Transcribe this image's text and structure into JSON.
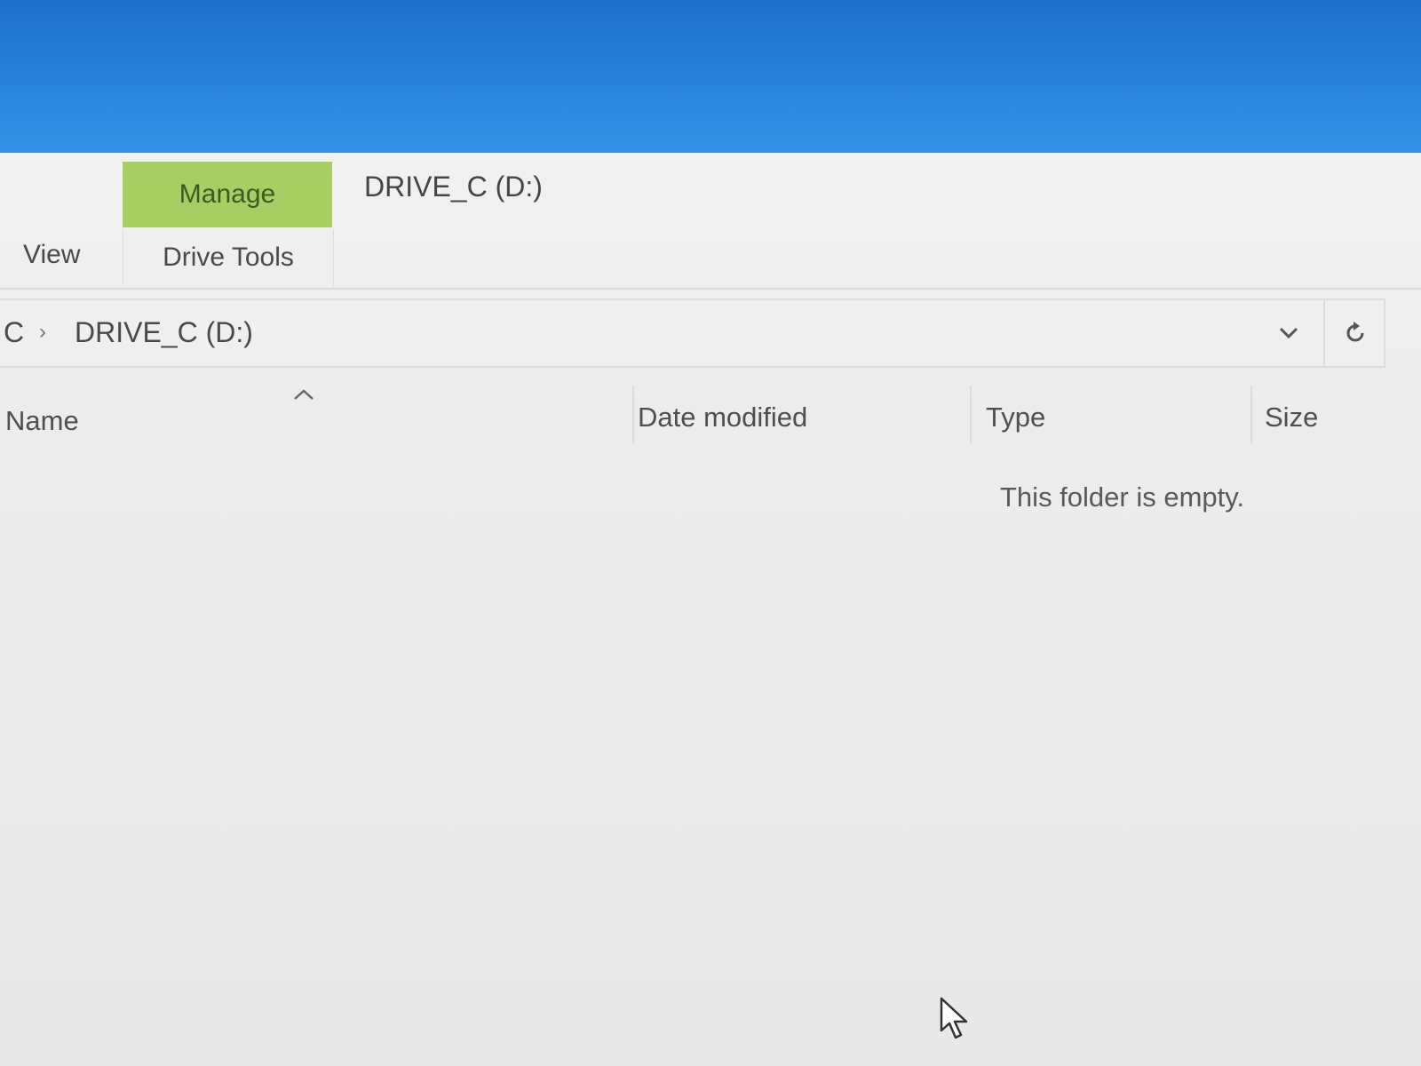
{
  "window": {
    "title": "DRIVE_C (D:)"
  },
  "ribbon": {
    "context_tab_group": "Manage",
    "tabs": [
      {
        "label": "View"
      },
      {
        "label": "Drive Tools"
      }
    ]
  },
  "address": {
    "crumbs": [
      "C",
      "DRIVE_C (D:)"
    ],
    "separator": "›"
  },
  "columns": {
    "name": "Name",
    "date_modified": "Date modified",
    "type": "Type",
    "size": "Size"
  },
  "content": {
    "empty_message": "This folder is empty."
  },
  "colors": {
    "desktop": "#2a86e0",
    "context_tab": "#a6cf63"
  },
  "icons": {
    "sort": "chevron-up-icon",
    "dropdown": "chevron-down-icon",
    "refresh": "refresh-icon",
    "cursor": "mouse-pointer-icon"
  }
}
